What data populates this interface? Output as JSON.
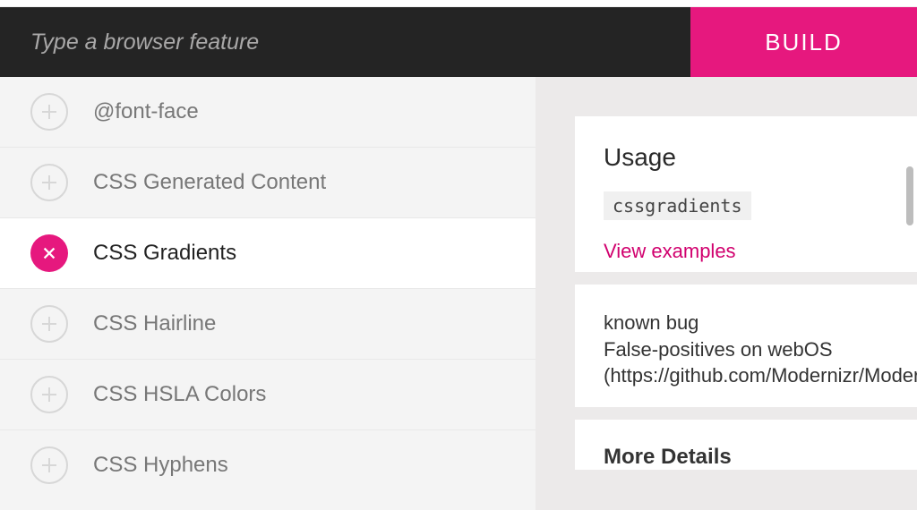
{
  "search": {
    "placeholder": "Type a browser feature"
  },
  "build_button": {
    "label": "BUILD"
  },
  "features": [
    {
      "label": "@font-face",
      "selected": false
    },
    {
      "label": "CSS Generated Content",
      "selected": false
    },
    {
      "label": "CSS Gradients",
      "selected": true
    },
    {
      "label": "CSS Hairline",
      "selected": false
    },
    {
      "label": "CSS HSLA Colors",
      "selected": false
    },
    {
      "label": "CSS Hyphens",
      "selected": false
    }
  ],
  "details": {
    "usage_heading": "Usage",
    "usage_code": "cssgradients",
    "examples_link": "View examples",
    "known_bug_heading": "known bug",
    "known_bug_line1": "False-positives on webOS",
    "known_bug_line2": "(https://github.com/Modernizr/Moder",
    "more_details_heading": "More Details"
  },
  "colors": {
    "accent": "#e6187e",
    "dark": "#242424"
  }
}
